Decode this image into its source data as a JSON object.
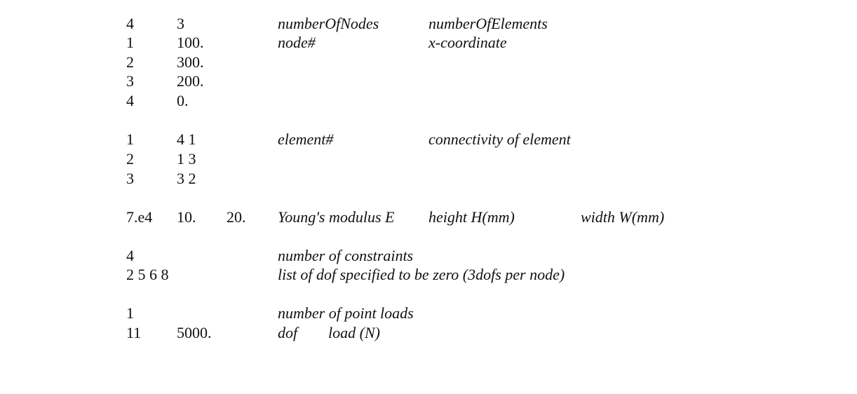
{
  "header": {
    "num_nodes": "4",
    "num_elements": "3",
    "label_nodes": "numberOfNodes",
    "label_elements": "numberOfElements"
  },
  "nodes": {
    "label_node": "node#",
    "label_coord": "x-coordinate",
    "rows": [
      {
        "id": "1",
        "x": "100."
      },
      {
        "id": "2",
        "x": "300."
      },
      {
        "id": "3",
        "x": "200."
      },
      {
        "id": "4",
        "x": "0."
      }
    ]
  },
  "elements": {
    "label_element": "element#",
    "label_conn": "connectivity of element",
    "rows": [
      {
        "id": "1",
        "conn": "4 1"
      },
      {
        "id": "2",
        "conn": "1 3"
      },
      {
        "id": "3",
        "conn": "3 2"
      }
    ]
  },
  "material": {
    "E": "7.e4",
    "H": "10.",
    "W": "20.",
    "label_E": "Young's modulus E",
    "label_H": "height H(mm)",
    "label_W": "width W(mm)"
  },
  "constraints": {
    "count": "4",
    "label_count": "number of constraints",
    "list": "2 5 6 8",
    "label_list": "list of dof specified to be zero (3dofs per node)"
  },
  "loads": {
    "count": "1",
    "label_count": "number of point loads",
    "dof": "11",
    "value": "5000.",
    "label_dof": "dof",
    "label_load": "load (N)"
  }
}
